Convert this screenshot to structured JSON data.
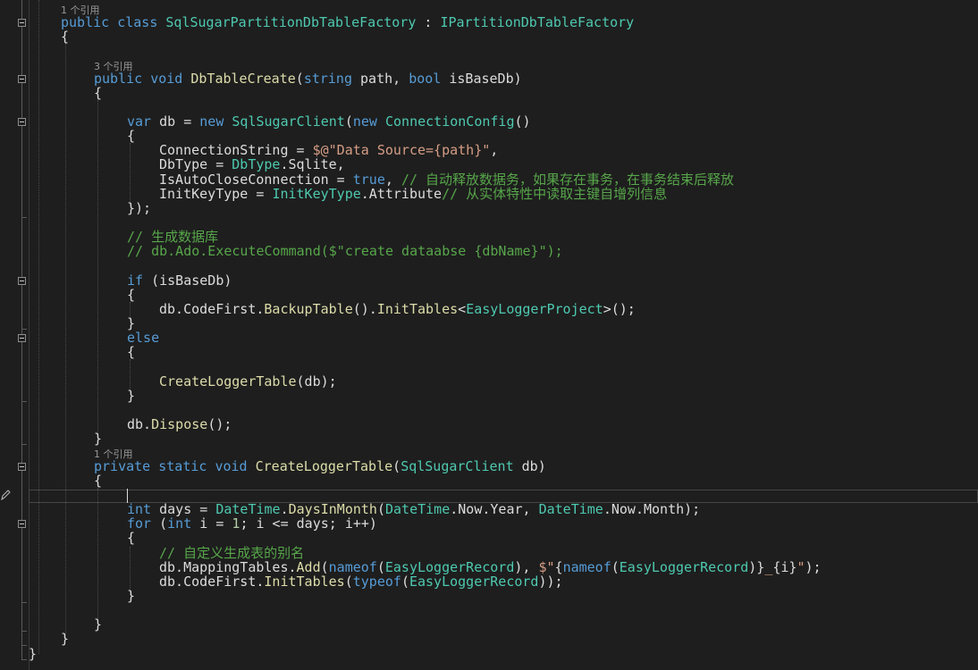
{
  "editor": {
    "lens": {
      "class_refs": "1 个引用",
      "create_refs": "3 个引用",
      "logger_refs": "1 个引用"
    },
    "code": {
      "class_decl": {
        "kw1": "public",
        "kw2": "class",
        "name": "SqlSugarPartitionDbTableFactory",
        "sep": " : ",
        "iface": "IPartitionDbTableFactory"
      },
      "brace_open": "{",
      "brace_close": "}",
      "m1": {
        "kw1": "public",
        "kw2": "void",
        "name": "DbTableCreate",
        "p_open": "(",
        "t1": "string",
        "p1": " path, ",
        "t2": "bool",
        "p2": " isBaseDb)"
      },
      "var_line": {
        "kw": "var",
        "a": " db = ",
        "kw2": "new",
        "sp": " ",
        "t1": "SqlSugarClient",
        "b": "(",
        "kw3": "new",
        "sp2": " ",
        "t2": "ConnectionConfig",
        "c": "()"
      },
      "cs_line": {
        "a": "ConnectionString = ",
        "s": "$@\"Data Source={path}\"",
        "b": ","
      },
      "dbtype_line": {
        "a": "DbType = ",
        "t": "DbType",
        "b": ".Sqlite,"
      },
      "auto_line": {
        "a": "IsAutoCloseConnection = ",
        "kw": "true",
        "b": ", ",
        "c": "// 自动释放数据务，如果存在事务，在事务结束后释放"
      },
      "initkey_line": {
        "a": "InitKeyType = ",
        "t": "InitKeyType",
        "b": ".Attribute",
        "c": "// 从实体特性中读取主键自增列信息"
      },
      "close_obj": "});",
      "cm_gen": "// 生成数据库",
      "cm_exec": "// db.Ado.ExecuteCommand($\"create dataabse {dbName}\");",
      "if_line": {
        "kw": "if",
        "a": " (isBaseDb)"
      },
      "backup_line": {
        "a": "db.CodeFirst.",
        "f1": "BackupTable",
        "b": "().",
        "f2": "InitTables",
        "c": "<",
        "t": "EasyLoggerProject",
        "d": ">();"
      },
      "else_kw": "else",
      "create_call": {
        "f": "CreateLoggerTable",
        "a": "(db);"
      },
      "dispose_line": {
        "a": "db.",
        "f": "Dispose",
        "b": "();"
      },
      "m2": {
        "kw1": "private",
        "kw2": "static",
        "kw3": "void",
        "name": "CreateLoggerTable",
        "a": "(",
        "t": "SqlSugarClient",
        "b": " db)"
      },
      "days_line": {
        "kw": "int",
        "a": " days = ",
        "t1": "DateTime",
        "b": ".",
        "f": "DaysInMonth",
        "c": "(",
        "t2": "DateTime",
        "d": ".Now.Year, ",
        "t3": "DateTime",
        "e": ".Now.Month);"
      },
      "for_line": {
        "kw": "for",
        "a": " (",
        "kw2": "int",
        "b": " i = ",
        "n": "1",
        "c": "; i <= days; i++)"
      },
      "cm_alias": "// 自定义生成表的别名",
      "mapping_line": {
        "a": "db.MappingTables.",
        "f": "Add",
        "b": "(",
        "kw": "nameof",
        "c": "(",
        "t": "EasyLoggerRecord",
        "d": "), ",
        "s1": "$\"",
        "e": "{",
        "kw2": "nameof",
        "g": "(",
        "t2": "EasyLoggerRecord",
        "h": ")}",
        "s2": "_",
        "i": "{i}",
        "s3": "\"",
        "j": ");"
      },
      "init_line": {
        "a": "db.CodeFirst.",
        "f": "InitTables",
        "b": "(",
        "kw": "typeof",
        "c": "(",
        "t": "EasyLoggerRecord",
        "d": "));"
      }
    }
  }
}
